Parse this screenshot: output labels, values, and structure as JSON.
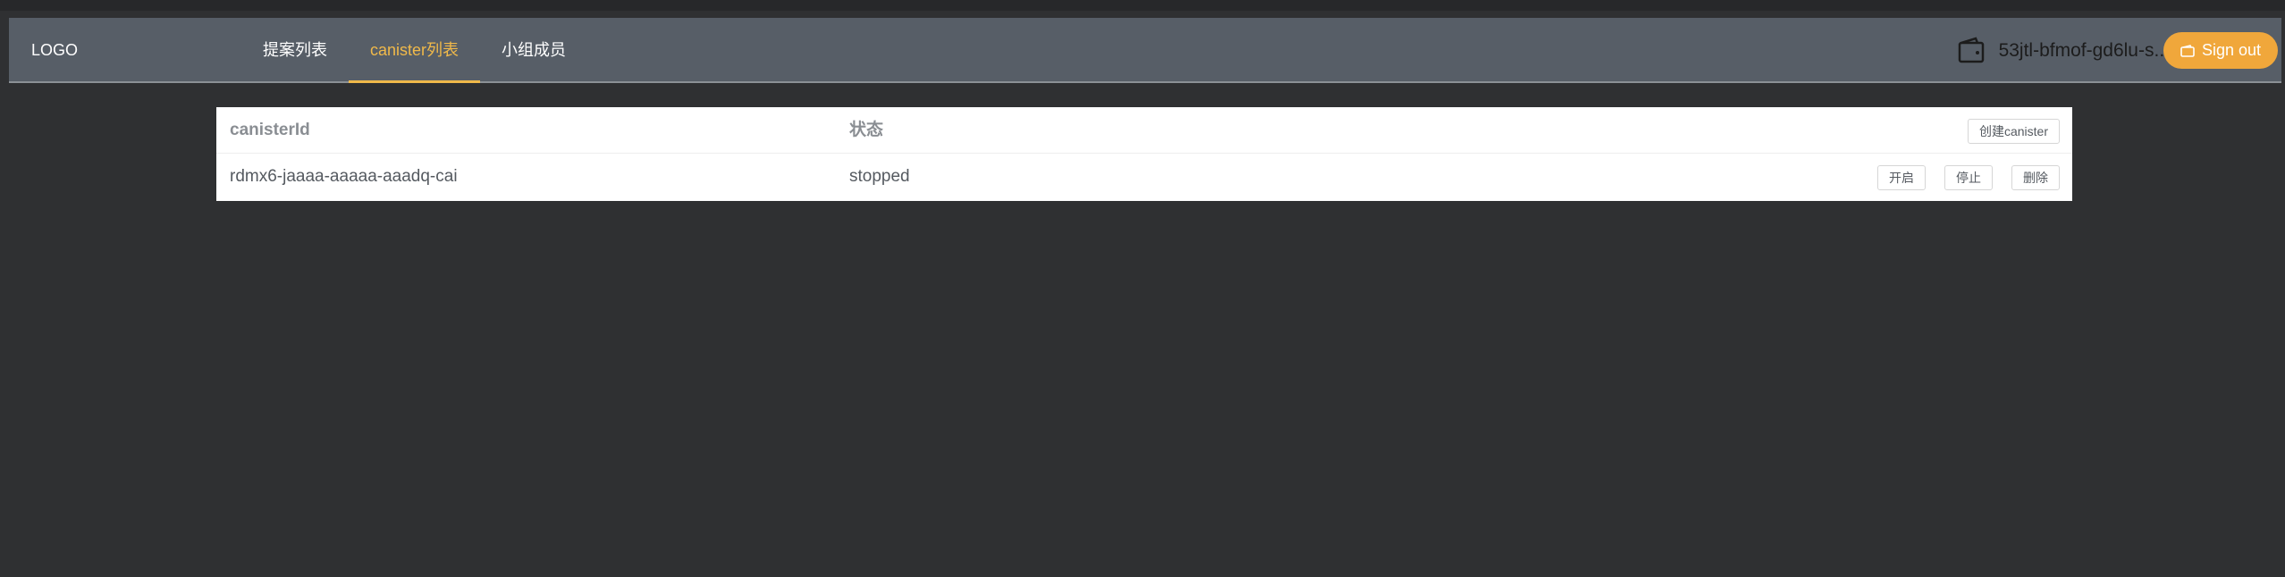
{
  "header": {
    "logo": "LOGO",
    "nav": [
      {
        "label": "提案列表",
        "active": false
      },
      {
        "label": "canister列表",
        "active": true
      },
      {
        "label": "小组成员",
        "active": false
      }
    ],
    "wallet_icon": "wallet-icon",
    "account": "53jtl-bfmof-gd6lu-s...",
    "signout_label": "Sign out",
    "signout_icon": "signout-icon",
    "accent_color": "#f0a73b"
  },
  "table": {
    "columns": [
      "canisterId",
      "状态"
    ],
    "create_button": "创建canister",
    "rows": [
      {
        "canister_id": "rdmx6-jaaaa-aaaaa-aaadq-cai",
        "status": "stopped",
        "actions": [
          "开启",
          "停止",
          "删除"
        ]
      }
    ]
  }
}
